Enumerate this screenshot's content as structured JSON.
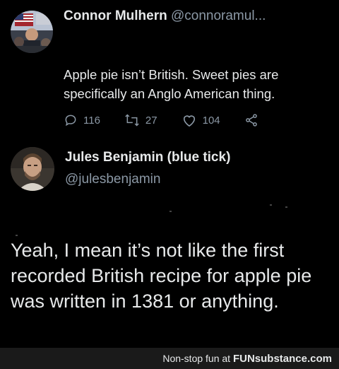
{
  "tweet": {
    "author_name": "Connor Mulhern",
    "author_handle": "@connoramul...",
    "text": "Apple pie isn’t British. Sweet pies are specifically an Anglo American thing.",
    "reply_count": "116",
    "retweet_count": "27",
    "like_count": "104"
  },
  "reply": {
    "author_name": "Jules Benjamin (blue tick)",
    "author_handle": "@julesbenjamin",
    "text": "Yeah, I mean it’s not like the first recorded British recipe for apple pie was written in 1381 or anything."
  },
  "footer": {
    "prefix": "Non-stop fun at ",
    "brand": "FUNsubstance.com"
  },
  "icons": [
    "reply-icon",
    "retweet-icon",
    "like-icon",
    "share-icon"
  ],
  "colors": {
    "background": "#000000",
    "text": "#e7e9ea",
    "secondary_text": "#8b98a5",
    "footer_bg": "#1a1a1a"
  }
}
